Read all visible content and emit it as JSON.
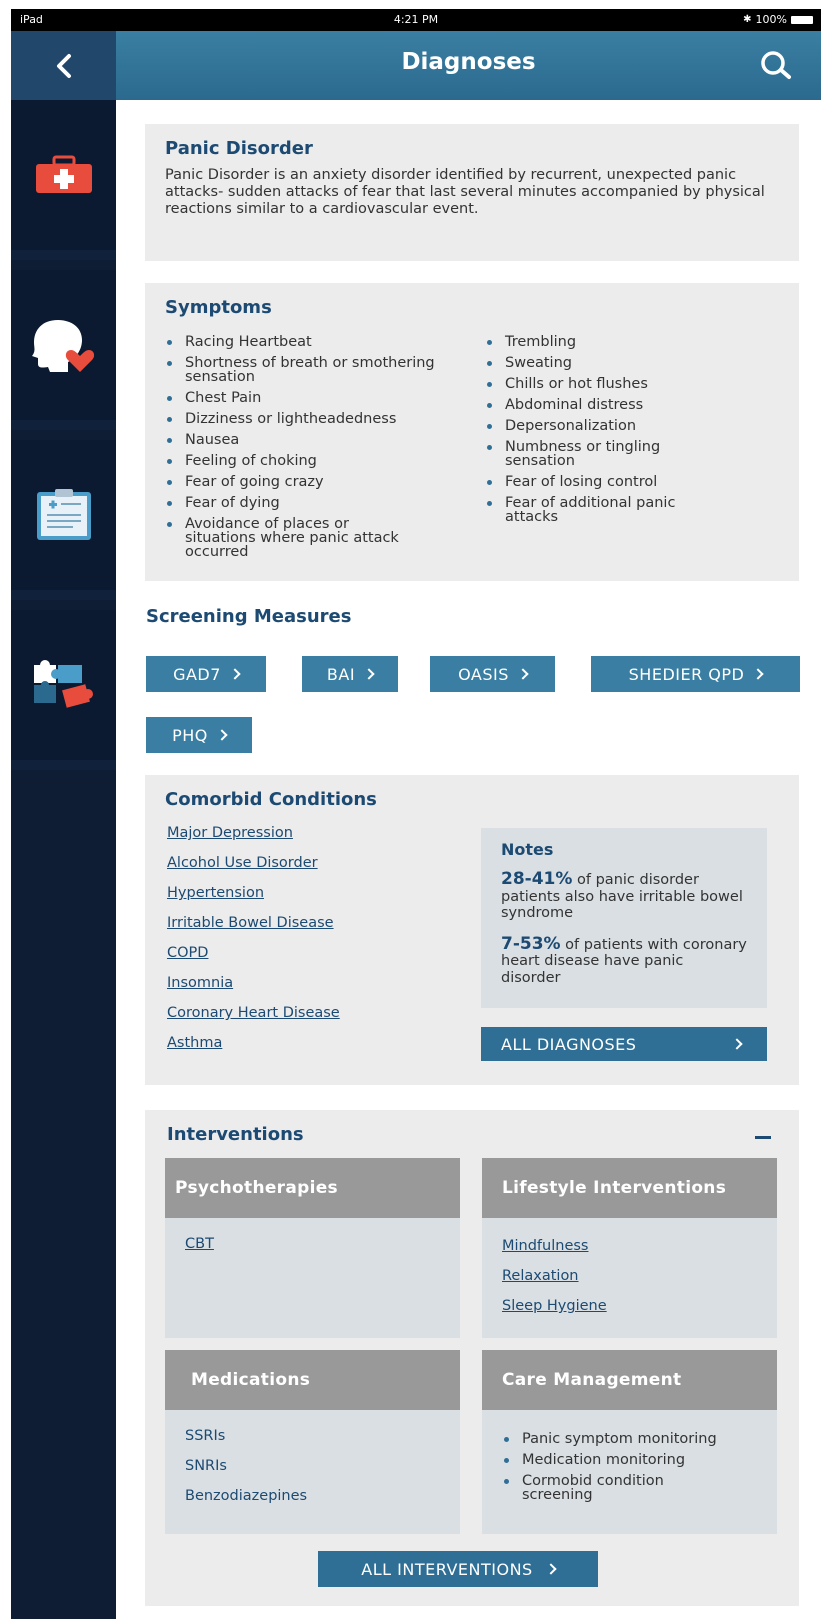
{
  "status_bar": {
    "device": "iPad",
    "time": "4:21 PM",
    "battery": "100%"
  },
  "header": {
    "title": "Diagnoses",
    "back_icon": "chevron-left-icon",
    "search_icon": "search-icon"
  },
  "sidebar": {
    "items": [
      {
        "icon": "first-aid-kit-icon"
      },
      {
        "icon": "head-heart-icon"
      },
      {
        "icon": "clipboard-icon"
      },
      {
        "icon": "puzzle-icon"
      }
    ]
  },
  "diagnosis": {
    "title": "Panic Disorder",
    "description": "Panic Disorder is an anxiety disorder identified by recurrent, unexpected panic attacks- sudden attacks of fear that last several minutes accompanied by physical reactions similar to a cardiovascular event."
  },
  "symptoms": {
    "title": "Symptoms",
    "left": [
      "Racing Heartbeat",
      "Shortness of breath or smothering sensation",
      "Chest Pain",
      "Dizziness or lightheadedness",
      "Nausea",
      "Feeling of choking",
      "Fear of going crazy",
      "Fear of dying",
      "Avoidance of places or situations where panic attack occurred"
    ],
    "right": [
      "Trembling",
      "Sweating",
      "Chills or hot flushes",
      "Abdominal distress",
      "Depersonalization",
      "Numbness or tingling sensation",
      "Fear of losing control",
      "Fear of additional panic attacks"
    ]
  },
  "screening": {
    "title": "Screening Measures",
    "buttons": [
      "GAD7",
      "BAI",
      "OASIS",
      "SHEDIER QPD",
      "PHQ"
    ]
  },
  "comorbid": {
    "title": "Comorbid Conditions",
    "links": [
      "Major Depression",
      "Alcohol Use Disorder",
      "Hypertension",
      "Irritable Bowel Disease",
      "COPD",
      "Insomnia",
      "Coronary Heart Disease",
      "Asthma"
    ],
    "notes": {
      "title": "Notes",
      "items": [
        {
          "stat": "28-41%",
          "text": " of panic disorder patients also have irritable bowel syndrome"
        },
        {
          "stat": "7-53%",
          "text": " of patients with coronary heart disease have panic disorder"
        }
      ]
    },
    "all_button": "ALL DIAGNOSES"
  },
  "interventions": {
    "title": "Interventions",
    "psychotherapies": {
      "title": "Psychotherapies",
      "links": [
        "CBT"
      ]
    },
    "lifestyle": {
      "title": "Lifestyle Interventions",
      "links": [
        "Mindfulness",
        "Relaxation",
        "Sleep Hygiene"
      ]
    },
    "medications": {
      "title": "Medications",
      "items": [
        "SSRIs",
        "SNRIs",
        "Benzodiazepines"
      ]
    },
    "care": {
      "title": "Care Management",
      "items": [
        "Panic symptom monitoring",
        "Medication monitoring",
        "Cormobid condition screening"
      ]
    },
    "all_button": "ALL INTERVENTIONS"
  }
}
